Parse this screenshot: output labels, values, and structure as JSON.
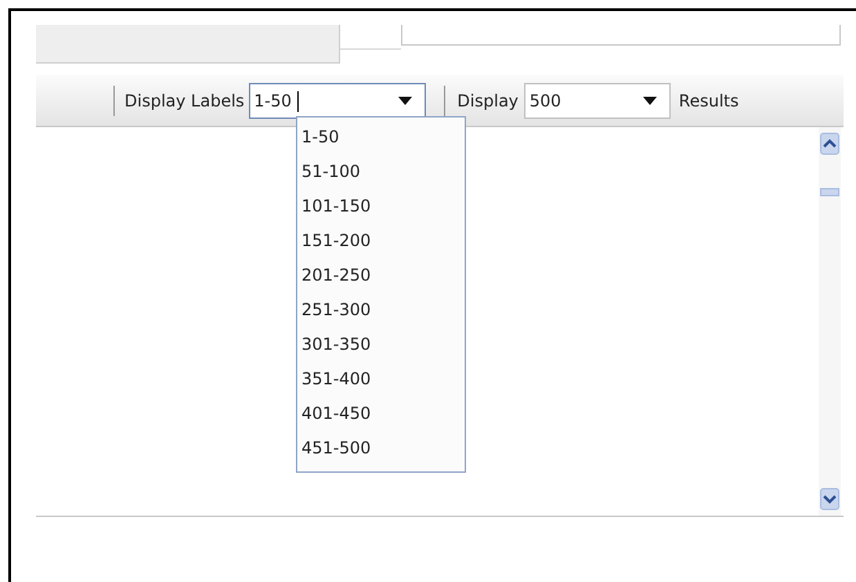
{
  "toolbar": {
    "labels_label": "Display Labels",
    "labels_combo": {
      "value": "1-50",
      "focused": true
    },
    "display_label": "Display",
    "display_combo": {
      "value": "500",
      "focused": false
    },
    "results_label": "Results"
  },
  "dropdown": {
    "options": [
      {
        "label": "1-50",
        "selected": false
      },
      {
        "label": "51-100",
        "selected": false
      },
      {
        "label": "101-150",
        "selected": false
      },
      {
        "label": "151-200",
        "selected": false
      },
      {
        "label": "201-250",
        "selected": false
      },
      {
        "label": "251-300",
        "selected": false
      },
      {
        "label": "301-350",
        "selected": false
      },
      {
        "label": "351-400",
        "selected": false
      },
      {
        "label": "401-450",
        "selected": false
      },
      {
        "label": "451-500",
        "selected": false
      }
    ]
  }
}
